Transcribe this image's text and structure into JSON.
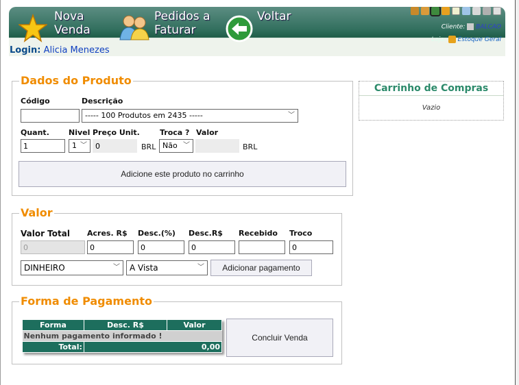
{
  "header": {
    "nova_venda": [
      "Nova",
      "Venda"
    ],
    "pedidos": [
      "Pedidos a",
      "Faturar"
    ],
    "voltar": "Voltar",
    "login_label": "Login:",
    "login_user": "Alicia Menezes",
    "cliente_label": "Cliente:",
    "cliente_value": "BALCAO",
    "loja_label": "Loja:",
    "loja_value": "Estoque Geral",
    "toolbar_icons": [
      "box-icon",
      "users-icon",
      "truck-icon",
      "bus-icon",
      "document-icon",
      "edit-icon",
      "calculator-icon",
      "gift-icon",
      "lock-icon"
    ]
  },
  "produto": {
    "legend": "Dados do Produto",
    "codigo_label": "Código",
    "descricao_label": "Descrição",
    "codigo_value": "",
    "descricao_value": "----- 100 Produtos em 2435 -----",
    "quant_label": "Quant.",
    "nivel_label": "Nivel",
    "preco_label": "Preço Unit.",
    "troca_label": "Troca ?",
    "valor_label": "Valor",
    "quant_value": "1",
    "nivel_value": "1",
    "preco_value": "0",
    "currency": "BRL",
    "troca_value": "Não",
    "valor_value": "",
    "add_button": "Adicione este produto no carrinho"
  },
  "cart": {
    "title": "Carrinho de Compras",
    "empty": "Vazio"
  },
  "valor": {
    "legend": "Valor",
    "labels": [
      "Valor Total",
      "Acres. R$",
      "Desc.(%)",
      "Desc.R$",
      "Recebido",
      "Troco"
    ],
    "total_value": "0",
    "acres_value": "0",
    "desc_pct_value": "0",
    "desc_rs_value": "0",
    "recebido_value": "",
    "troco_value": "0",
    "forma_select": "DINHEIRO",
    "prazo_select": "A Vista",
    "add_payment_button": "Adicionar pagamento"
  },
  "pagamento": {
    "legend": "Forma de Pagamento",
    "columns": [
      "Forma",
      "Desc. R$",
      "Valor"
    ],
    "empty_row": "Nenhum pagamento informado !",
    "total_label": "Total:",
    "total_value": "0,00",
    "concluir_button": "Concluir Venda"
  },
  "colors": {
    "accent_orange": "#f08c00",
    "header_green": "#1f5d48",
    "cart_green": "#2b8a6a"
  }
}
